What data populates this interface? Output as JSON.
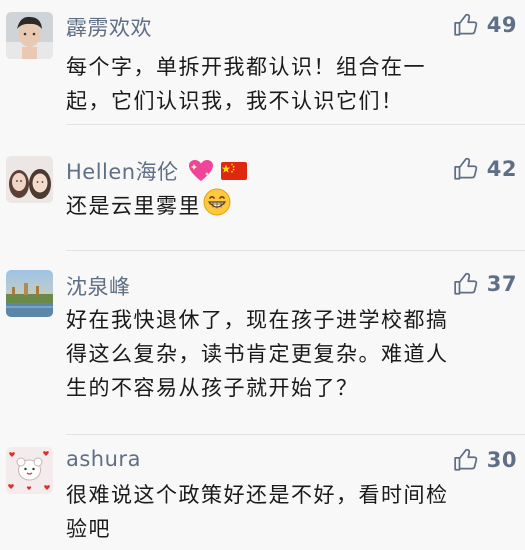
{
  "comments": [
    {
      "user": "霹雳欢欢",
      "likes": "49",
      "lines": [
        "每个字，单拆开我都认识！组合在一",
        "起，它们认识我，我不认识它们！"
      ]
    },
    {
      "user": "Hellen海伦",
      "user_badges": [
        "sparkling-heart-emoji",
        "china-flag-emoji"
      ],
      "likes": "42",
      "lines": [
        "还是云里雾里"
      ],
      "trailing_emoji": "grinning-face-emoji"
    },
    {
      "user": "沈泉峰",
      "likes": "37",
      "lines": [
        "好在我快退休了，现在孩子进学校都搞",
        "得这么复杂，读书肯定更复杂。难道人",
        "生的不容易从孩子就开始了？"
      ]
    },
    {
      "user": "ashura",
      "likes": "30",
      "lines": [
        "很难说这个政策好还是不好，看时间检",
        "验吧"
      ]
    }
  ],
  "colors": {
    "username": "#5f6f86",
    "body_text": "#1a1a1a",
    "background": "#f8f8f8",
    "divider": "#e3e3e3"
  }
}
